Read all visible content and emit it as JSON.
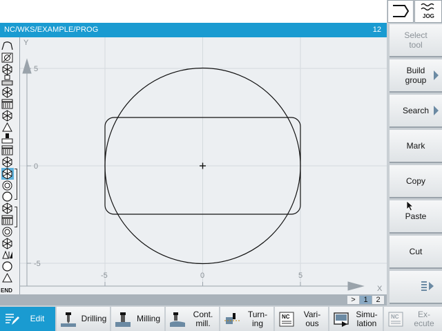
{
  "title_bar": {
    "path": "NC/WKS/EXAMPLE/PROG",
    "number": "12"
  },
  "mode_buttons": [
    {
      "name": "program-mode",
      "icon": "program-return-icon"
    },
    {
      "name": "jog-mode",
      "icon": "jog-icon",
      "label": "JOG"
    }
  ],
  "softkeys": [
    {
      "label": "Select\ntool",
      "enabled": false,
      "arrow": false
    },
    {
      "label": "Build\ngroup",
      "enabled": true,
      "arrow": true
    },
    {
      "label": "Search",
      "enabled": true,
      "arrow": true
    },
    {
      "label": "Mark",
      "enabled": true,
      "arrow": false
    },
    {
      "label": "Copy",
      "enabled": true,
      "arrow": false
    },
    {
      "label": "Paste",
      "enabled": true,
      "arrow": false
    },
    {
      "label": "Cut",
      "enabled": true,
      "arrow": false
    },
    {
      "icon": "more-menu-icon",
      "enabled": true,
      "arrow": true
    }
  ],
  "bottom_bar": [
    {
      "label": "Edit",
      "icon": "edit-icon",
      "active": true
    },
    {
      "label": "Drilling",
      "icon": "drilling-icon"
    },
    {
      "label": "Milling",
      "icon": "milling-icon"
    },
    {
      "label": "Cont.\nmill.",
      "icon": "contour-milling-icon"
    },
    {
      "label": "Turn-\ning",
      "icon": "turning-icon"
    },
    {
      "label": "Vari-\nous",
      "icon": "various-nc-icon"
    },
    {
      "label": "Simu-\nlation",
      "icon": "simulation-icon"
    },
    {
      "label": "Ex-\necute",
      "icon": "execute-nc-icon",
      "enabled": false
    }
  ],
  "graphic": {
    "axis_x_label": "X",
    "axis_y_label": "Y",
    "x_ticks": [
      "-5",
      "0",
      "5"
    ],
    "y_ticks": [
      "5",
      "0",
      "-5"
    ]
  },
  "tool_strip": {
    "icons": [
      "program-header-icon",
      "contour-icon",
      "cycle-icon",
      "pocket-icon",
      "cycle-icon",
      "face-icon",
      "cycle-icon",
      "point-icon",
      "drill-icon",
      "face-icon",
      "cycle-icon",
      "cycle-icon",
      "circle-pocket-icon",
      "circle-icon",
      "cycle-icon",
      "face-icon",
      "circle-pocket-icon",
      "cycle-icon",
      "transform-icon",
      "circle-icon",
      "point-icon"
    ],
    "selected_index": 11,
    "end_label": "END"
  },
  "page_indicator": {
    "arrow": ">",
    "pages": [
      "1",
      "2"
    ],
    "active_page": "1"
  }
}
